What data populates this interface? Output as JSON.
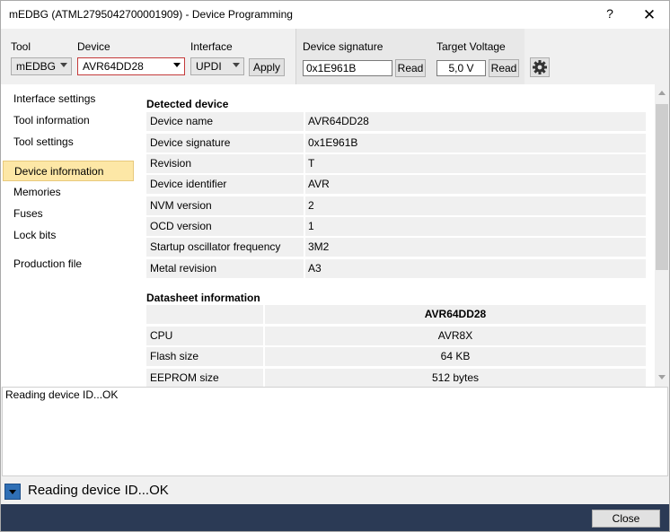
{
  "window": {
    "title": "mEDBG (ATML2795042700001909) - Device Programming",
    "help": "?",
    "close": "✕"
  },
  "toolbar": {
    "tool_label": "Tool",
    "tool_value": "mEDBG",
    "device_label": "Device",
    "device_value": "AVR64DD28",
    "interface_label": "Interface",
    "interface_value": "UPDI",
    "apply": "Apply",
    "signature_label": "Device signature",
    "signature_value": "0x1E961B",
    "signature_read": "Read",
    "voltage_label": "Target Voltage",
    "voltage_value": "5,0 V",
    "voltage_read": "Read"
  },
  "nav": {
    "items": [
      "Interface settings",
      "Tool information",
      "Tool settings",
      "Device information",
      "Memories",
      "Fuses",
      "Lock bits",
      "Production file"
    ]
  },
  "detected": {
    "heading": "Detected device",
    "rows": [
      [
        "Device name",
        "AVR64DD28"
      ],
      [
        "Device signature",
        "0x1E961B"
      ],
      [
        "Revision",
        "T"
      ],
      [
        "Device identifier",
        "AVR"
      ],
      [
        "NVM version",
        "2"
      ],
      [
        "OCD version",
        "1"
      ],
      [
        "Startup oscillator frequency",
        "3M2"
      ],
      [
        "Metal revision",
        "A3"
      ]
    ]
  },
  "datasheet": {
    "heading": "Datasheet information",
    "column_header": "AVR64DD28",
    "rows": [
      [
        "CPU",
        "AVR8X"
      ],
      [
        "Flash size",
        "64 KB"
      ],
      [
        "EEPROM size",
        "512 bytes"
      ]
    ]
  },
  "log": {
    "text": "Reading device ID...OK"
  },
  "status": {
    "text": "Reading device ID...OK"
  },
  "footer": {
    "close": "Close"
  }
}
